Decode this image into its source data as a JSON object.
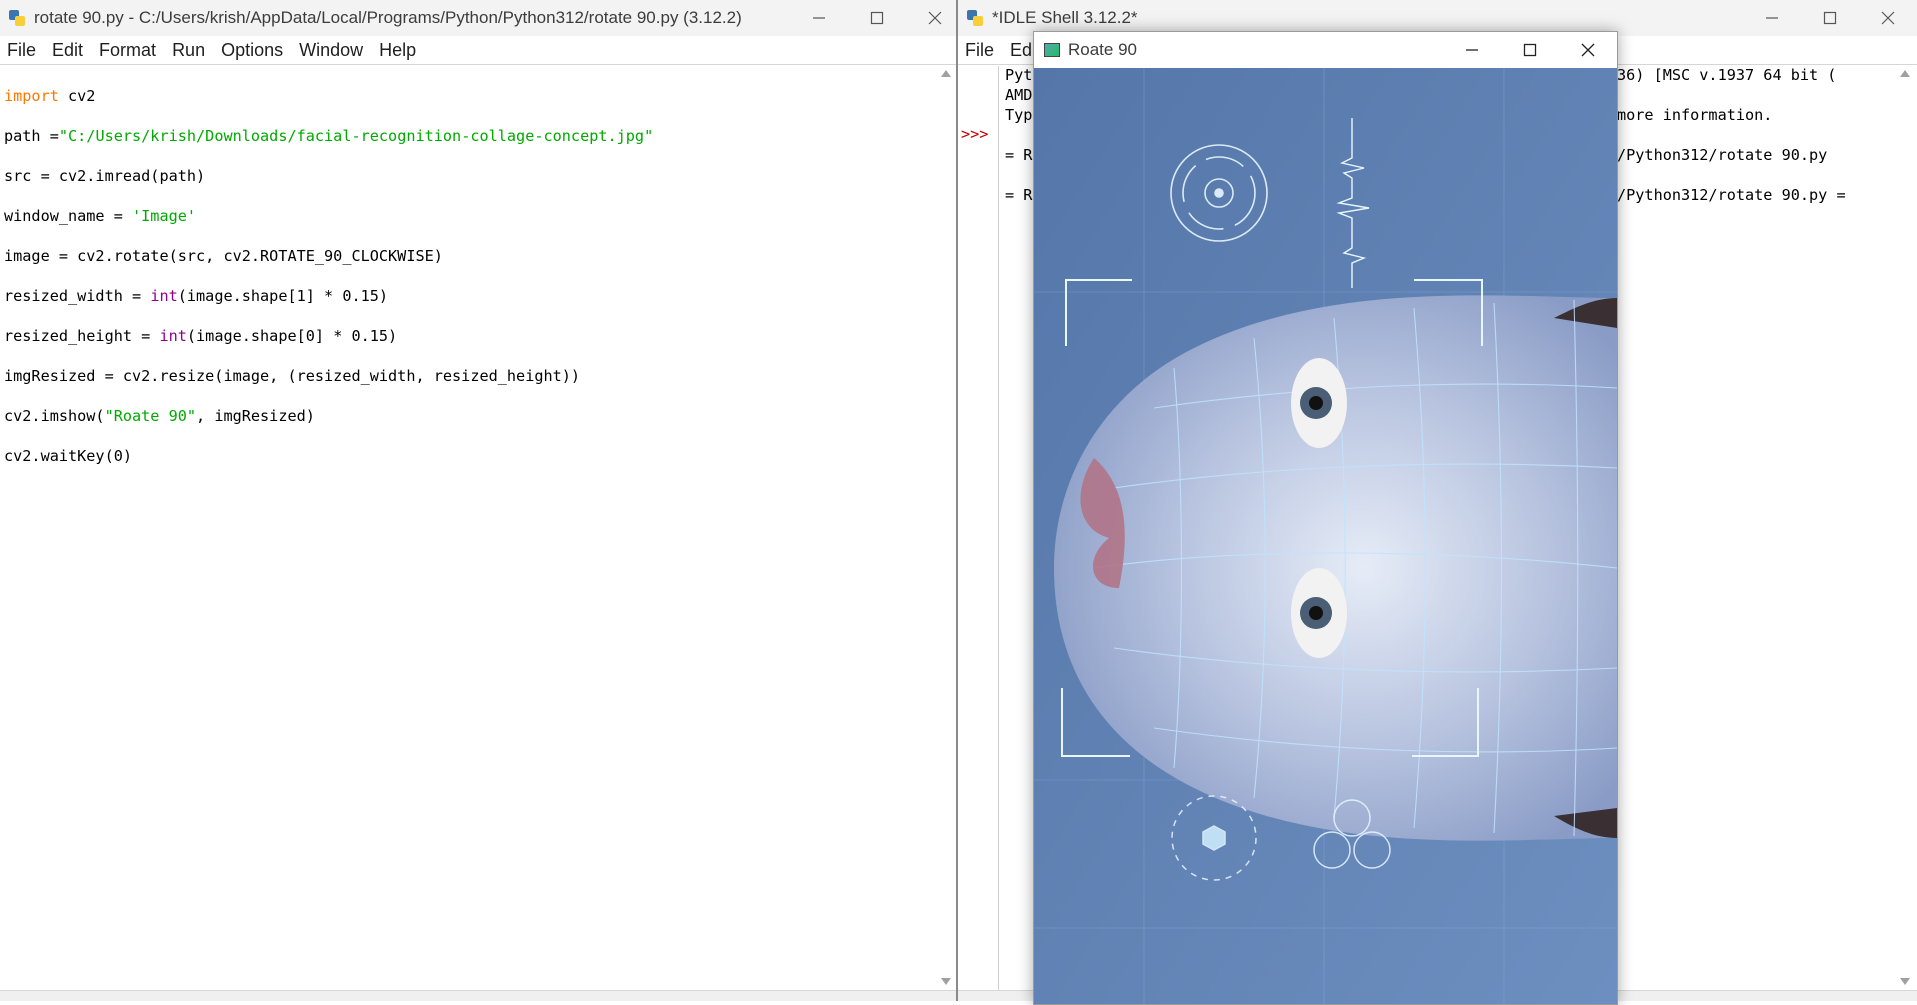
{
  "editor": {
    "title": "rotate 90.py - C:/Users/krish/AppData/Local/Programs/Python/Python312/rotate 90.py (3.12.2)",
    "menu": [
      "File",
      "Edit",
      "Format",
      "Run",
      "Options",
      "Window",
      "Help"
    ],
    "code": {
      "l1_kw": "import",
      "l1_rest": " cv2",
      "l2_a": "path =",
      "l2_str": "\"C:/Users/krish/Downloads/facial-recognition-collage-concept.jpg\"",
      "l3": "src = cv2.imread(path)",
      "l4_a": "window_name = ",
      "l4_str": "'Image'",
      "l5": "image = cv2.rotate(src, cv2.ROTATE_90_CLOCKWISE)",
      "l6_a": "resized_width = ",
      "l6_bi": "int",
      "l6_b": "(image.shape[1] * 0.15)",
      "l7_a": "resized_height = ",
      "l7_bi": "int",
      "l7_b": "(image.shape[0] * 0.15)",
      "l8": "imgResized = cv2.resize(image, (resized_width, resized_height))",
      "l9_a": "cv2.imshow(",
      "l9_str": "\"Roate 90\"",
      "l9_b": ", imgResized)",
      "l10": "cv2.waitKey(0)"
    }
  },
  "shell": {
    "title": "*IDLE Shell 3.12.2*",
    "menu": [
      "File",
      "Edi"
    ],
    "prompt": ">>>",
    "lines": {
      "a1": "Pyt",
      "a2": "AMD",
      "a3": "Typ",
      "a4": "= R",
      "a5": "= R",
      "b1": "36) [MSC v.1937 64 bit (",
      "b2": "more information.",
      "b3": "/Python312/rotate 90.py",
      "b4": "/Python312/rotate 90.py ="
    }
  },
  "cvwindow": {
    "title": "Roate 90"
  },
  "colors": {
    "keyword": "#ff7700",
    "string": "#00aa00",
    "builtin": "#900090",
    "prompt": "#c00000",
    "image_bg": "#5e84b5",
    "mesh": "#bfe4ff"
  }
}
